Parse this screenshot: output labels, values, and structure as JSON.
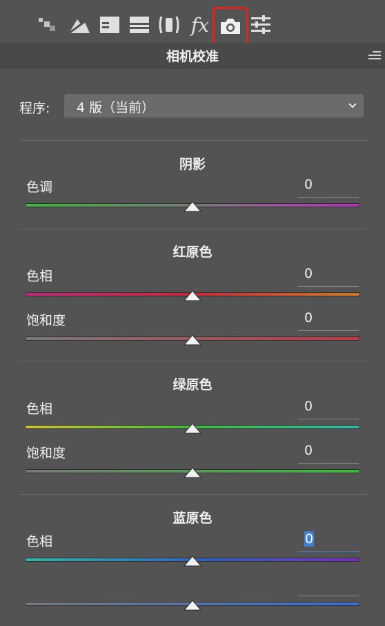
{
  "panel": {
    "title": "相机校准"
  },
  "toolbar": {
    "tools": [
      "basic-icon",
      "tone-curve-icon",
      "detail-icon",
      "hsl-icon",
      "lens-corrections-icon",
      "effects-icon",
      "camera-calibration-icon",
      "presets-icon"
    ],
    "effects_label": "fx",
    "active_tool": "camera-calibration-icon",
    "highlight_color": "#e0241b"
  },
  "process": {
    "label": "程序:",
    "value": "4 版（当前）"
  },
  "sections": [
    {
      "title": "阴影",
      "sliders": [
        {
          "label": "色调",
          "value": "0"
        }
      ]
    },
    {
      "title": "红原色",
      "sliders": [
        {
          "label": "色相",
          "value": "0"
        },
        {
          "label": "饱和度",
          "value": "0"
        }
      ]
    },
    {
      "title": "绿原色",
      "sliders": [
        {
          "label": "色相",
          "value": "0"
        },
        {
          "label": "饱和度",
          "value": "0"
        }
      ]
    },
    {
      "title": "蓝原色",
      "sliders": [
        {
          "label": "色相",
          "value": "0"
        },
        {
          "label": "",
          "value": ""
        }
      ]
    }
  ],
  "slider_positions": {
    "note_free": 0.5
  }
}
